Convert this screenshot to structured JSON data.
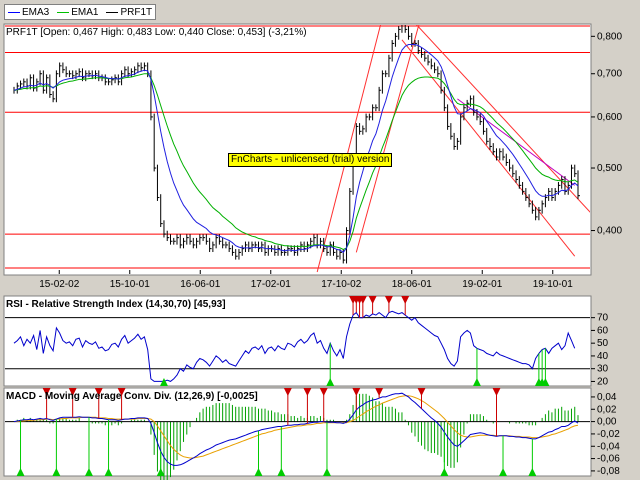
{
  "legend": {
    "items": [
      {
        "label": "EMA3",
        "color": "#0000ff"
      },
      {
        "label": "EMA1",
        "color": "#00c000"
      },
      {
        "label": "PRF1T",
        "color": "#000000"
      }
    ]
  },
  "watermark": "FnCharts - unlicensed (trial) version",
  "colors": {
    "price": "#000000",
    "ema3": "#2020e0",
    "ema1": "#00b000",
    "hline": "#ff0000",
    "channel": "#ff3030",
    "rsi": "#0000cc",
    "macd": "#0000cc",
    "signal": "#e8a000",
    "hist": "#00a000",
    "buy": "#00cc00",
    "sell": "#cc0000"
  },
  "chart_data": [
    {
      "type": "line",
      "title": "PRF1T [Open: 0,467  High: 0,483  Low: 0,440  Close: 0,453] (-3,21%)",
      "x_tick_labels": [
        "15-02-02",
        "15-10-01",
        "16-06-01",
        "17-02-01",
        "17-10-02",
        "18-06-01",
        "19-02-01",
        "19-10-01"
      ],
      "y_tick_labels": [
        "0,400",
        "0,500",
        "0,600",
        "0,700",
        "0,800"
      ],
      "y_ticks": [
        0.4,
        0.5,
        0.6,
        0.7,
        0.8
      ],
      "ylim": [
        0.345,
        0.83
      ],
      "y_scale": "log",
      "horizontal_lines": [
        0.35,
        0.395,
        0.61,
        0.755,
        0.83
      ],
      "price": [
        0.66,
        0.67,
        0.675,
        0.68,
        0.67,
        0.69,
        0.665,
        0.68,
        0.7,
        0.66,
        0.69,
        0.65,
        0.64,
        0.7,
        0.72,
        0.71,
        0.7,
        0.7,
        0.695,
        0.7,
        0.705,
        0.69,
        0.7,
        0.7,
        0.695,
        0.7,
        0.69,
        0.69,
        0.68,
        0.68,
        0.685,
        0.69,
        0.68,
        0.7,
        0.71,
        0.7,
        0.705,
        0.71,
        0.72,
        0.715,
        0.72,
        0.7,
        0.6,
        0.5,
        0.45,
        0.41,
        0.395,
        0.39,
        0.385,
        0.385,
        0.39,
        0.38,
        0.385,
        0.39,
        0.385,
        0.38,
        0.385,
        0.39,
        0.39,
        0.385,
        0.375,
        0.38,
        0.39,
        0.385,
        0.38,
        0.38,
        0.375,
        0.37,
        0.365,
        0.37,
        0.375,
        0.38,
        0.375,
        0.38,
        0.38,
        0.375,
        0.38,
        0.37,
        0.375,
        0.375,
        0.37,
        0.375,
        0.37,
        0.37,
        0.375,
        0.375,
        0.37,
        0.375,
        0.38,
        0.375,
        0.38,
        0.385,
        0.39,
        0.38,
        0.385,
        0.375,
        0.37,
        0.38,
        0.37,
        0.365,
        0.37,
        0.36,
        0.4,
        0.46,
        0.52,
        0.58,
        0.57,
        0.575,
        0.6,
        0.6,
        0.62,
        0.62,
        0.66,
        0.7,
        0.7,
        0.74,
        0.78,
        0.8,
        0.82,
        0.84,
        0.82,
        0.8,
        0.78,
        0.78,
        0.76,
        0.75,
        0.74,
        0.73,
        0.72,
        0.71,
        0.7,
        0.66,
        0.62,
        0.58,
        0.56,
        0.54,
        0.55,
        0.6,
        0.62,
        0.63,
        0.64,
        0.61,
        0.6,
        0.59,
        0.57,
        0.55,
        0.54,
        0.53,
        0.52,
        0.53,
        0.52,
        0.51,
        0.5,
        0.49,
        0.48,
        0.47,
        0.46,
        0.45,
        0.44,
        0.43,
        0.42,
        0.43,
        0.44,
        0.45,
        0.46,
        0.45,
        0.46,
        0.47,
        0.48,
        0.46,
        0.47,
        0.5,
        0.49,
        0.453
      ],
      "ema3": [
        0.66,
        0.662,
        0.665,
        0.668,
        0.668,
        0.672,
        0.67,
        0.672,
        0.677,
        0.673,
        0.676,
        0.671,
        0.665,
        0.672,
        0.68,
        0.684,
        0.686,
        0.688,
        0.689,
        0.691,
        0.694,
        0.693,
        0.694,
        0.695,
        0.695,
        0.696,
        0.694,
        0.693,
        0.691,
        0.689,
        0.688,
        0.688,
        0.687,
        0.69,
        0.694,
        0.695,
        0.697,
        0.699,
        0.704,
        0.706,
        0.709,
        0.707,
        0.686,
        0.649,
        0.609,
        0.57,
        0.538,
        0.512,
        0.491,
        0.474,
        0.461,
        0.448,
        0.438,
        0.431,
        0.424,
        0.417,
        0.412,
        0.409,
        0.406,
        0.403,
        0.398,
        0.395,
        0.394,
        0.392,
        0.39,
        0.388,
        0.386,
        0.383,
        0.379,
        0.377,
        0.376,
        0.376,
        0.376,
        0.376,
        0.377,
        0.376,
        0.377,
        0.375,
        0.375,
        0.375,
        0.374,
        0.374,
        0.373,
        0.372,
        0.373,
        0.373,
        0.372,
        0.373,
        0.374,
        0.374,
        0.375,
        0.377,
        0.379,
        0.379,
        0.38,
        0.379,
        0.377,
        0.378,
        0.376,
        0.374,
        0.373,
        0.37,
        0.376,
        0.393,
        0.419,
        0.451,
        0.475,
        0.494,
        0.516,
        0.532,
        0.551,
        0.565,
        0.587,
        0.614,
        0.635,
        0.662,
        0.692,
        0.716,
        0.74,
        0.762,
        0.772,
        0.777,
        0.777,
        0.777,
        0.774,
        0.769,
        0.763,
        0.756,
        0.749,
        0.741,
        0.733,
        0.718,
        0.697,
        0.671,
        0.646,
        0.622,
        0.607,
        0.606,
        0.609,
        0.613,
        0.618,
        0.616,
        0.613,
        0.609,
        0.602,
        0.591,
        0.581,
        0.571,
        0.561,
        0.555,
        0.548,
        0.541,
        0.533,
        0.525,
        0.516,
        0.507,
        0.498,
        0.489,
        0.48,
        0.47,
        0.461,
        0.455,
        0.452,
        0.452,
        0.454,
        0.453,
        0.455,
        0.458,
        0.462,
        0.461,
        0.463,
        0.47,
        0.474,
        0.469
      ],
      "ema1": [
        0.66,
        0.661,
        0.662,
        0.664,
        0.664,
        0.666,
        0.666,
        0.667,
        0.67,
        0.669,
        0.671,
        0.669,
        0.667,
        0.67,
        0.674,
        0.677,
        0.679,
        0.681,
        0.682,
        0.684,
        0.686,
        0.686,
        0.687,
        0.688,
        0.689,
        0.69,
        0.69,
        0.69,
        0.689,
        0.688,
        0.688,
        0.688,
        0.687,
        0.688,
        0.69,
        0.691,
        0.692,
        0.694,
        0.696,
        0.698,
        0.7,
        0.7,
        0.69,
        0.671,
        0.649,
        0.625,
        0.602,
        0.581,
        0.562,
        0.545,
        0.531,
        0.516,
        0.504,
        0.494,
        0.484,
        0.474,
        0.466,
        0.459,
        0.453,
        0.447,
        0.44,
        0.434,
        0.43,
        0.426,
        0.421,
        0.417,
        0.413,
        0.409,
        0.404,
        0.401,
        0.398,
        0.396,
        0.394,
        0.392,
        0.391,
        0.389,
        0.388,
        0.386,
        0.385,
        0.384,
        0.382,
        0.381,
        0.38,
        0.379,
        0.379,
        0.378,
        0.378,
        0.378,
        0.378,
        0.378,
        0.378,
        0.379,
        0.38,
        0.38,
        0.38,
        0.38,
        0.379,
        0.379,
        0.378,
        0.377,
        0.376,
        0.374,
        0.376,
        0.385,
        0.399,
        0.418,
        0.433,
        0.447,
        0.462,
        0.476,
        0.491,
        0.504,
        0.52,
        0.538,
        0.554,
        0.572,
        0.592,
        0.61,
        0.629,
        0.648,
        0.661,
        0.672,
        0.679,
        0.685,
        0.689,
        0.691,
        0.692,
        0.692,
        0.691,
        0.69,
        0.689,
        0.684,
        0.676,
        0.665,
        0.652,
        0.639,
        0.63,
        0.627,
        0.627,
        0.627,
        0.628,
        0.627,
        0.625,
        0.622,
        0.617,
        0.61,
        0.603,
        0.596,
        0.588,
        0.582,
        0.576,
        0.569,
        0.562,
        0.555,
        0.548,
        0.54,
        0.532,
        0.524,
        0.516,
        0.508,
        0.5,
        0.494,
        0.489,
        0.486,
        0.484,
        0.481,
        0.479,
        0.478,
        0.478,
        0.476,
        0.476,
        0.478,
        0.479,
        0.475
      ],
      "channel_lines": [
        {
          "from": [
            105,
            0.37
          ],
          "to": [
            128,
            0.98
          ]
        },
        {
          "from": [
            93,
            0.345
          ],
          "to": [
            116,
            0.98
          ]
        },
        {
          "from": [
            119,
            0.79
          ],
          "to": [
            172,
            0.365
          ]
        },
        {
          "from": [
            121,
            0.86
          ],
          "to": [
            180,
            0.41
          ]
        }
      ],
      "fit_line": {
        "from": [
          136,
          0.64
        ],
        "to": [
          172,
          0.47
        ]
      }
    },
    {
      "type": "line",
      "title": "RSI - Relative Strength Index (14,30,70) [45,93]",
      "y_tick_labels": [
        "20",
        "30",
        "40",
        "50",
        "60",
        "70"
      ],
      "y_ticks": [
        20,
        30,
        40,
        50,
        60,
        70
      ],
      "ylim": [
        18,
        76
      ],
      "levels": [
        30,
        70
      ],
      "values": [
        50,
        52,
        55,
        48,
        53,
        50,
        56,
        45,
        60,
        42,
        55,
        48,
        44,
        62,
        58,
        52,
        50,
        51,
        48,
        53,
        54,
        47,
        52,
        50,
        49,
        51,
        46,
        47,
        44,
        45,
        49,
        50,
        47,
        53,
        56,
        50,
        52,
        54,
        57,
        53,
        55,
        45,
        22,
        20,
        20,
        20,
        20,
        21,
        20,
        22,
        25,
        30,
        28,
        33,
        31,
        30,
        35,
        38,
        37,
        35,
        32,
        36,
        40,
        38,
        35,
        37,
        34,
        33,
        32,
        36,
        40,
        44,
        42,
        46,
        47,
        45,
        48,
        42,
        46,
        47,
        44,
        48,
        46,
        45,
        50,
        49,
        47,
        51,
        53,
        50,
        52,
        56,
        58,
        50,
        52,
        46,
        42,
        50,
        44,
        40,
        45,
        38,
        55,
        65,
        72,
        74,
        70,
        70,
        72,
        71,
        73,
        72,
        74,
        72,
        70,
        74,
        75,
        74,
        73,
        74,
        72,
        70,
        68,
        70,
        66,
        64,
        62,
        60,
        58,
        56,
        55,
        50,
        45,
        38,
        34,
        32,
        36,
        55,
        58,
        60,
        58,
        48,
        46,
        45,
        44,
        42,
        41,
        40,
        43,
        41,
        40,
        39,
        38,
        37,
        36,
        35,
        34,
        34,
        33,
        30,
        38,
        42,
        45,
        46,
        42,
        46,
        48,
        50,
        45,
        48,
        58,
        52,
        46
      ],
      "buy_signals": [
        46,
        97,
        142,
        161,
        162,
        163
      ],
      "sell_signals": [
        104,
        105,
        106,
        107,
        110,
        115,
        120
      ]
    },
    {
      "type": "bar",
      "title": "MACD - Moving Average Conv. Div. (12,26,9) [-0,0025]",
      "y_tick_labels": [
        "-0,08",
        "-0,06",
        "-0,04",
        "-0,02",
        "0,00",
        "0,02",
        "0,04"
      ],
      "y_ticks": [
        -0.08,
        -0.06,
        -0.04,
        -0.02,
        0.0,
        0.02,
        0.04
      ],
      "ylim": [
        -0.085,
        0.048
      ],
      "macd": [
        0,
        0.001,
        0.002,
        0.003,
        0.003,
        0.004,
        0.003,
        0.004,
        0.005,
        0.004,
        0.005,
        0.003,
        0.002,
        0.004,
        0.006,
        0.007,
        0.007,
        0.007,
        0.007,
        0.007,
        0.008,
        0.007,
        0.007,
        0.007,
        0.006,
        0.006,
        0.005,
        0.005,
        0.004,
        0.003,
        0.003,
        0.003,
        0.002,
        0.003,
        0.004,
        0.004,
        0.005,
        0.005,
        0.006,
        0.006,
        0.006,
        0.005,
        -0.003,
        -0.018,
        -0.034,
        -0.048,
        -0.058,
        -0.065,
        -0.069,
        -0.071,
        -0.071,
        -0.07,
        -0.068,
        -0.065,
        -0.062,
        -0.059,
        -0.056,
        -0.052,
        -0.049,
        -0.046,
        -0.044,
        -0.041,
        -0.038,
        -0.036,
        -0.034,
        -0.032,
        -0.03,
        -0.029,
        -0.028,
        -0.026,
        -0.024,
        -0.022,
        -0.02,
        -0.018,
        -0.016,
        -0.015,
        -0.013,
        -0.012,
        -0.011,
        -0.01,
        -0.009,
        -0.008,
        -0.008,
        -0.007,
        -0.006,
        -0.006,
        -0.005,
        -0.005,
        -0.004,
        -0.004,
        -0.003,
        -0.002,
        -0.001,
        -0.001,
        0,
        0,
        -0.001,
        -0.001,
        -0.001,
        -0.002,
        -0.002,
        -0.003,
        -0.001,
        0.004,
        0.011,
        0.019,
        0.024,
        0.027,
        0.031,
        0.033,
        0.035,
        0.036,
        0.038,
        0.04,
        0.04,
        0.042,
        0.044,
        0.045,
        0.045,
        0.046,
        0.043,
        0.04,
        0.035,
        0.031,
        0.026,
        0.021,
        0.016,
        0.011,
        0.006,
        0.002,
        -0.003,
        -0.009,
        -0.017,
        -0.025,
        -0.032,
        -0.038,
        -0.04,
        -0.036,
        -0.031,
        -0.026,
        -0.021,
        -0.02,
        -0.019,
        -0.018,
        -0.019,
        -0.021,
        -0.022,
        -0.023,
        -0.024,
        -0.023,
        -0.023,
        -0.023,
        -0.024,
        -0.024,
        -0.025,
        -0.025,
        -0.026,
        -0.026,
        -0.027,
        -0.028,
        -0.028,
        -0.026,
        -0.023,
        -0.02,
        -0.017,
        -0.016,
        -0.013,
        -0.011,
        -0.008,
        -0.008,
        -0.006,
        -0.002,
        0.001,
        -0.0025
      ],
      "signal": [
        0,
        0,
        0.001,
        0.001,
        0.002,
        0.002,
        0.002,
        0.003,
        0.003,
        0.003,
        0.004,
        0.004,
        0.003,
        0.004,
        0.004,
        0.005,
        0.005,
        0.006,
        0.006,
        0.006,
        0.006,
        0.007,
        0.007,
        0.007,
        0.007,
        0.007,
        0.006,
        0.006,
        0.006,
        0.005,
        0.005,
        0.004,
        0.004,
        0.004,
        0.004,
        0.004,
        0.004,
        0.004,
        0.005,
        0.005,
        0.005,
        0.005,
        0.004,
        0,
        -0.007,
        -0.015,
        -0.023,
        -0.031,
        -0.039,
        -0.045,
        -0.05,
        -0.054,
        -0.057,
        -0.058,
        -0.059,
        -0.059,
        -0.058,
        -0.057,
        -0.056,
        -0.054,
        -0.052,
        -0.05,
        -0.048,
        -0.046,
        -0.044,
        -0.042,
        -0.04,
        -0.038,
        -0.036,
        -0.034,
        -0.032,
        -0.03,
        -0.028,
        -0.026,
        -0.024,
        -0.022,
        -0.02,
        -0.019,
        -0.017,
        -0.016,
        -0.014,
        -0.013,
        -0.012,
        -0.011,
        -0.01,
        -0.009,
        -0.008,
        -0.007,
        -0.007,
        -0.006,
        -0.005,
        -0.005,
        -0.004,
        -0.003,
        -0.003,
        -0.002,
        -0.002,
        -0.002,
        -0.002,
        -0.002,
        -0.002,
        -0.002,
        -0.002,
        0,
        0.002,
        0.005,
        0.009,
        0.012,
        0.016,
        0.019,
        0.022,
        0.025,
        0.027,
        0.03,
        0.032,
        0.034,
        0.036,
        0.038,
        0.04,
        0.041,
        0.042,
        0.042,
        0.041,
        0.039,
        0.037,
        0.034,
        0.031,
        0.027,
        0.023,
        0.019,
        0.015,
        0.01,
        0.005,
        -0.001,
        -0.007,
        -0.013,
        -0.018,
        -0.022,
        -0.024,
        -0.025,
        -0.025,
        -0.024,
        -0.023,
        -0.022,
        -0.022,
        -0.022,
        -0.022,
        -0.022,
        -0.023,
        -0.023,
        -0.023,
        -0.023,
        -0.023,
        -0.024,
        -0.024,
        -0.024,
        -0.025,
        -0.025,
        -0.025,
        -0.026,
        -0.026,
        -0.026,
        -0.025,
        -0.024,
        -0.023,
        -0.021,
        -0.02,
        -0.018,
        -0.016,
        -0.014,
        -0.012,
        -0.009,
        -0.007,
        -0.006
      ],
      "buy_signals": [
        2,
        13,
        23,
        29,
        45,
        75,
        82,
        96,
        132,
        150,
        159
      ],
      "sell_signals": [
        10,
        18,
        26,
        33,
        84,
        90,
        95,
        105,
        112,
        125,
        148
      ]
    }
  ]
}
